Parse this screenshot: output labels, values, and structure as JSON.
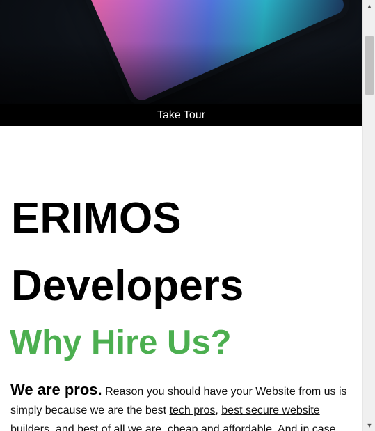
{
  "hero": {
    "tour_label": "Take Tour"
  },
  "main": {
    "brand_title": "ERIMOS Developers",
    "why_title": "Why Hire Us?",
    "intro": {
      "lead": "We are pros.",
      "text_1": " Reason you should have your Website from us is simply because we are the best ",
      "link_1": "tech pros",
      "text_2": ", ",
      "link_2": "best secure website builders",
      "text_3": ", and best of all we are, cheap and affordable. And in case"
    }
  },
  "scrollbar": {
    "up_icon": "scroll-up-arrow",
    "down_icon": "scroll-down-arrow"
  }
}
